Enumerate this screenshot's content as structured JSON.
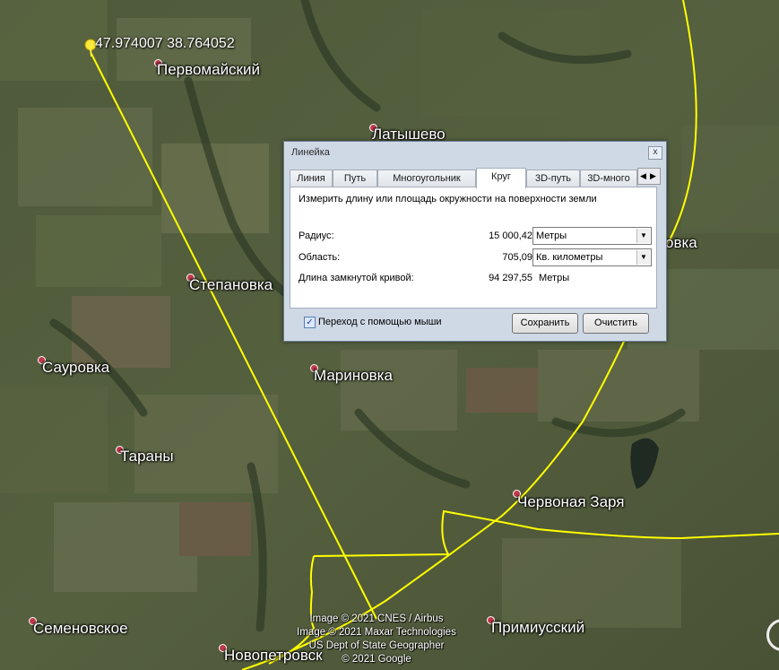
{
  "map": {
    "marker_coords": "47.974007 38.764052",
    "places": [
      {
        "name": "Первомайский"
      },
      {
        "name": "Латышево"
      },
      {
        "name": "Степановка"
      },
      {
        "name": "Сауровка"
      },
      {
        "name": "Мариновка"
      },
      {
        "name": "Тараны"
      },
      {
        "name": "Червоная Заря"
      },
      {
        "name": "Семеновское"
      },
      {
        "name": "Примиусский"
      },
      {
        "name": "Новопетровск"
      },
      {
        "name": "овка"
      }
    ],
    "credits": [
      "Image © 2021 CNES / Airbus",
      "Image © 2021 Maxar Technologies",
      "US Dept of State Geographer",
      "© 2021 Google"
    ],
    "colors": {
      "measure_line": "#ffff00",
      "place_dot": "#c0394a"
    }
  },
  "ruler": {
    "title": "Линейка",
    "close_label": "x",
    "tabs": [
      "Линия",
      "Путь",
      "Многоугольник",
      "Круг",
      "3D-путь",
      "3D-много"
    ],
    "active_tab": "Круг",
    "description": "Измерить длину или площадь окружности на поверхности земли",
    "radius_label": "Радиус:",
    "radius_value": "15 000,42",
    "radius_unit": "Метры",
    "area_label": "Область:",
    "area_value": "705,09",
    "area_unit": "Кв. километры",
    "perimeter_label": "Длина замкнутой кривой:",
    "perimeter_value": "94 297,55",
    "perimeter_unit": "Метры",
    "mouse_nav_label": "Переход с помощью мыши",
    "mouse_nav_checked": true,
    "save_label": "Сохранить",
    "clear_label": "Очистить"
  }
}
